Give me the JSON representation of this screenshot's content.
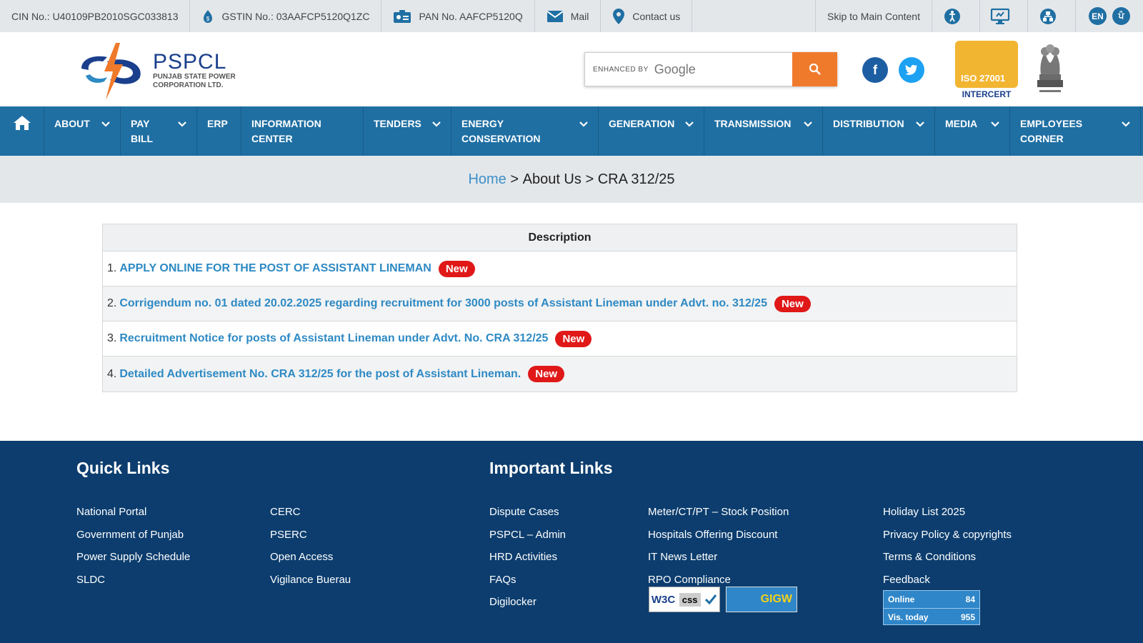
{
  "topbar": {
    "cin": "CIN No.: U40109PB2010SGC033813",
    "gstin": "GSTIN No.: 03AAFCP5120Q1ZC",
    "pan": "PAN No. AAFCP5120Q",
    "mail": "Mail",
    "contact": "Contact us",
    "skip": "Skip to Main Content",
    "lang_en": "EN",
    "lang_pa": "ਪੰ"
  },
  "header": {
    "logo_title": "PSPCL",
    "logo_sub1": "PUNJAB STATE POWER",
    "logo_sub2": "CORPORATION LTD.",
    "search_prefix": "ENHANCED BY",
    "search_brand": "Google",
    "iso_text": "ISO 27001",
    "iso_label": "INTERCERT"
  },
  "nav": [
    {
      "line1": "ABOUT",
      "line2": "",
      "dropdown": true
    },
    {
      "line1": "PAY",
      "line2": "BILL",
      "dropdown": true
    },
    {
      "line1": "ERP",
      "line2": "",
      "dropdown": false
    },
    {
      "line1": "INFORMATION",
      "line2": "CENTER",
      "dropdown": false
    },
    {
      "line1": "TENDERS",
      "line2": "",
      "dropdown": true
    },
    {
      "line1": "ENERGY",
      "line2": "CONSERVATION",
      "dropdown": true
    },
    {
      "line1": "GENERATION",
      "line2": "",
      "dropdown": true
    },
    {
      "line1": "TRANSMISSION",
      "line2": "",
      "dropdown": true
    },
    {
      "line1": "DISTRIBUTION",
      "line2": "",
      "dropdown": true
    },
    {
      "line1": "MEDIA",
      "line2": "",
      "dropdown": true
    },
    {
      "line1": "EMPLOYEES",
      "line2": "CORNER",
      "dropdown": true
    }
  ],
  "breadcrumb": {
    "home": "Home",
    "sep": ">",
    "level1": "About Us",
    "level2": "CRA 312/25"
  },
  "table": {
    "header": "Description",
    "badge": "New",
    "rows": [
      {
        "num": "1.",
        "text": "APPLY ONLINE FOR THE POST OF ASSISTANT LINEMAN"
      },
      {
        "num": "2.",
        "text": "Corrigendum no. 01 dated 20.02.2025 regarding recruitment for 3000 posts of Assistant Lineman under Advt. no. 312/25"
      },
      {
        "num": "3.",
        "text": "Recruitment Notice for posts of Assistant Lineman under Advt. No. CRA 312/25"
      },
      {
        "num": "4.",
        "text": "Detailed Advertisement No. CRA 312/25 for the post of Assistant Lineman."
      }
    ]
  },
  "footer": {
    "quick_title": "Quick Links",
    "important_title": "Important Links",
    "quick_col1": [
      "National Portal",
      "Government of Punjab",
      "Power Supply Schedule",
      "SLDC"
    ],
    "quick_col2": [
      "CERC",
      "PSERC",
      "Open Access",
      "Vigilance Buerau"
    ],
    "imp_col1": [
      "Dispute Cases",
      "PSPCL – Admin",
      "HRD Activities",
      "FAQs",
      "Digilocker"
    ],
    "imp_col2": [
      "Meter/CT/PT – Stock Position",
      "Hospitals Offering Discount",
      "IT News Letter",
      "RPO Compliance"
    ],
    "imp_col3": [
      "Holiday List 2025",
      "Privacy Policy & copyrights",
      "Terms & Conditions",
      "Feedback"
    ],
    "w3c_text": "W3C",
    "css_text": "css",
    "gigw_text": "GIGW",
    "counter": {
      "online_label": "Online",
      "online_value": "84",
      "today_label": "Vis. today",
      "today_value": "955"
    }
  },
  "colors": {
    "nav": "#1f6fa3",
    "footer": "#0c3d6e",
    "search_button": "#f07a2c",
    "link": "#2e8ac4",
    "badge": "#e01818"
  }
}
